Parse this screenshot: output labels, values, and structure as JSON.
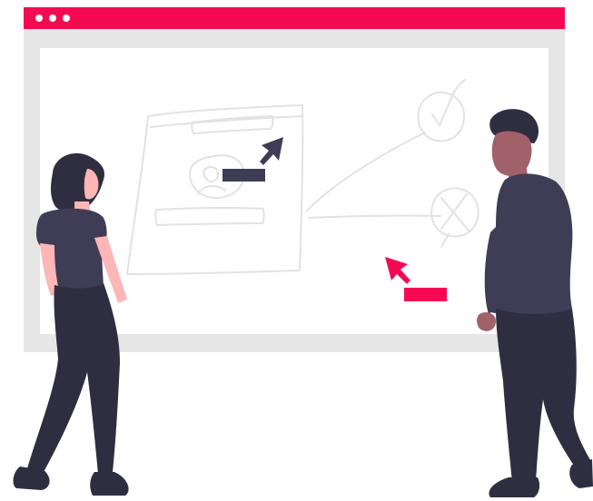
{
  "colors": {
    "accent": "#f50a52",
    "frame": "#e6e6e6",
    "screen": "#ffffff",
    "sketch": "#e2e2e2",
    "dark": "#3f3d56",
    "navy": "#2f2e41",
    "skin_light": "#ffb6b6",
    "skin_dark": "#a0616a",
    "hair": "#2f2e41"
  },
  "window": {
    "controls": [
      "dot",
      "dot",
      "dot"
    ]
  },
  "icons": {
    "window_dots": "three-dots-icon",
    "cursor_dark": "arrow-cursor-icon",
    "cursor_accent": "arrow-cursor-icon",
    "check": "checkmark-circle-icon",
    "cross": "x-circle-icon",
    "avatar": "avatar-placeholder-icon"
  }
}
